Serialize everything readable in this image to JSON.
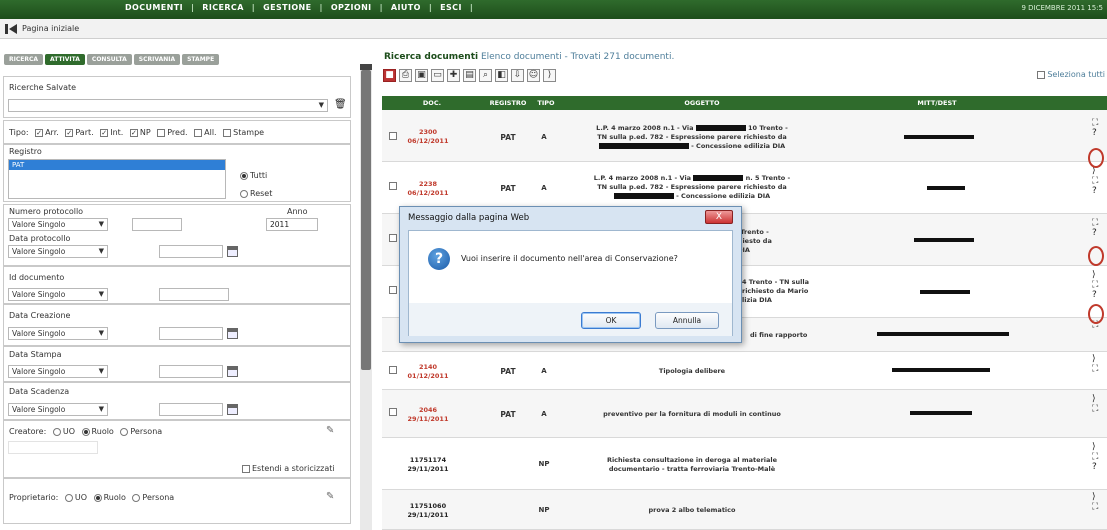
{
  "topbar": {
    "menu": [
      "DOCUMENTI",
      "RICERCA",
      "GESTIONE",
      "OPZIONI",
      "AIUTO",
      "ESCI"
    ],
    "date": "9 DICEMBRE 2011 15:5"
  },
  "home": {
    "label": "Pagina iniziale"
  },
  "tabs": [
    "RICERCA",
    "ATTIVITA",
    "CONSULTA",
    "SCRIVANIA",
    "STAMPE"
  ],
  "saved_searches": {
    "label": "Ricerche Salvate"
  },
  "tipo": {
    "label": "Tipo:",
    "options": [
      {
        "label": "Arr.",
        "checked": true
      },
      {
        "label": "Part.",
        "checked": true
      },
      {
        "label": "Int.",
        "checked": true
      },
      {
        "label": "NP",
        "checked": true
      },
      {
        "label": "Pred.",
        "checked": false
      },
      {
        "label": "All.",
        "checked": false
      },
      {
        "label": "Stampe",
        "checked": false
      }
    ]
  },
  "registro": {
    "label": "Registro",
    "selected": "PAT",
    "radio_tutti": "Tutti",
    "radio_reset": "Reset"
  },
  "fields": {
    "numero_protocollo": "Numero protocollo",
    "anno_label": "Anno",
    "anno_value": "2011",
    "data_protocollo": "Data protocollo",
    "id_documento": "Id documento",
    "data_creazione": "Data Creazione",
    "data_stampa": "Data Stampa",
    "data_scadenza": "Data Scadenza",
    "valore_singolo": "Valore Singolo"
  },
  "creatore": {
    "label": "Creatore:",
    "uo": "UO",
    "ruolo": "Ruolo",
    "persona": "Persona",
    "estendi": "Estendi a storicizzati"
  },
  "proprietario": {
    "label": "Proprietario:",
    "uo": "UO",
    "ruolo": "Ruolo",
    "persona": "Persona"
  },
  "results": {
    "title": "Ricerca documenti",
    "subtitle": "Elenco documenti - Trovati 271 documenti.",
    "select_all": "Seleziona tutti",
    "headers": [
      "DOC.",
      "REGISTRO",
      "TIPO",
      "OGGETTO",
      "MITT/DEST"
    ],
    "rows": [
      {
        "doc": "2300",
        "date": "06/12/2011",
        "registro": "PAT",
        "tipo": "A",
        "ogg1": "L.P. 4 marzo 2008 n.1 - Via",
        "ogg1b": "10 Trento -",
        "ogg2": "TN sulla p.ed. 782 - Espressione parere richiesto da",
        "ogg3": "- Concessione edilizia DIA"
      },
      {
        "doc": "2238",
        "date": "06/12/2011",
        "registro": "PAT",
        "tipo": "A",
        "ogg1": "L.P. 4 marzo 2008 n.1 - Via",
        "ogg1b": "n. 5 Trento -",
        "ogg2": "TN sulla p.ed. 782 - Espressione parere richiesto da",
        "ogg3": "- Concessione edilizia DIA"
      },
      {
        "doc": "",
        "date": "",
        "registro": "",
        "tipo": "",
        "ogg1": "Prato n. 5 Trento -",
        "ogg2": "parere richiesto da",
        "ogg3": "e edilizia DIA"
      },
      {
        "doc": "",
        "date": "",
        "registro": "",
        "tipo": "",
        "ogg1": "4 Trento - TN sulla",
        "ogg2": "richiesto da Mario",
        "ogg3": "lizia DIA"
      },
      {
        "doc": "",
        "date": "",
        "registro": "",
        "tipo": "",
        "ogg1": "di fine rapporto"
      },
      {
        "doc": "2140",
        "date": "01/12/2011",
        "registro": "PAT",
        "tipo": "A",
        "ogg1": "Tipologia delibere"
      },
      {
        "doc": "2046",
        "date": "29/11/2011",
        "registro": "PAT",
        "tipo": "A",
        "ogg1": "preventivo per la fornitura di moduli in continuo"
      },
      {
        "doc": "11751174",
        "date": "29/11/2011",
        "registro": "",
        "tipo": "NP",
        "ogg1": "Richiesta consultazione in deroga al materiale",
        "ogg2": "documentario - tratta ferroviaria Trento-Malè"
      },
      {
        "doc": "11751060",
        "date": "29/11/2011",
        "registro": "",
        "tipo": "NP",
        "ogg1": "prova 2 albo telematico"
      }
    ]
  },
  "dialog": {
    "title": "Messaggio dalla pagina Web",
    "message": "Vuoi inserire il documento nell'area di Conservazione?",
    "ok": "OK",
    "cancel": "Annulla",
    "close": "X"
  }
}
